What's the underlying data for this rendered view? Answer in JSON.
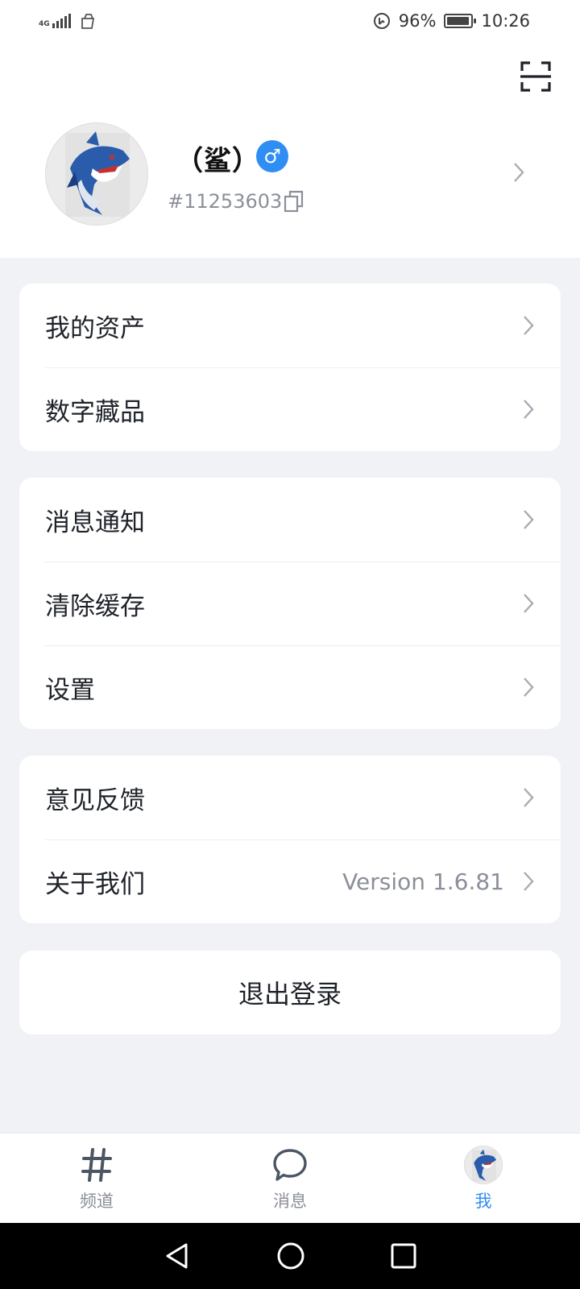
{
  "status_bar": {
    "network": "4G",
    "battery_text": "96%",
    "battery_level": 0.96,
    "time": "10:26"
  },
  "profile": {
    "nickname": "（鲨）",
    "gender_symbol": "♂",
    "user_id": "#11253603"
  },
  "menu_groups": [
    {
      "items": [
        {
          "label": "我的资产"
        },
        {
          "label": "数字藏品"
        }
      ]
    },
    {
      "items": [
        {
          "label": "消息通知"
        },
        {
          "label": "清除缓存"
        },
        {
          "label": "设置"
        }
      ]
    },
    {
      "items": [
        {
          "label": "意见反馈"
        },
        {
          "label": "关于我们",
          "value": "Version 1.6.81"
        }
      ]
    }
  ],
  "logout_label": "退出登录",
  "tabbar": {
    "tabs": [
      {
        "label": "频道",
        "icon": "hashtag-icon"
      },
      {
        "label": "消息",
        "icon": "chat-bubble-icon"
      },
      {
        "label": "我",
        "icon": "avatar"
      }
    ],
    "active_color": "#2f8ef3"
  },
  "accent_color": "#2f8ef3"
}
